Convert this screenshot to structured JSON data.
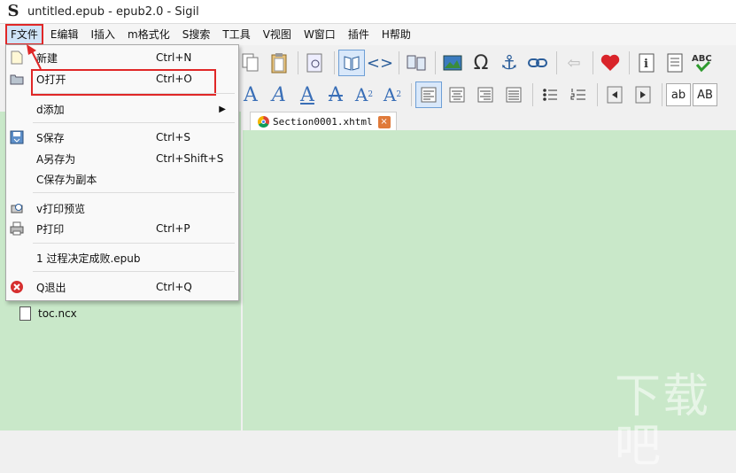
{
  "window": {
    "title": "untitled.epub - epub2.0 - Sigil",
    "logo_glyph": "S"
  },
  "menubar": {
    "items": [
      "F文件",
      "E编辑",
      "I插入",
      "m格式化",
      "S搜索",
      "T工具",
      "V视图",
      "W窗口",
      "插件",
      "H帮助"
    ]
  },
  "file_menu": {
    "items": [
      {
        "label": "新建",
        "shortcut": "Ctrl+N",
        "icon": "new-file-icon"
      },
      {
        "label": "O打开",
        "shortcut": "Ctrl+O",
        "icon": "open-folder-icon"
      },
      {
        "label": "d添加",
        "shortcut": "",
        "icon": "",
        "submenu": true
      },
      {
        "label": "S保存",
        "shortcut": "Ctrl+S",
        "icon": "save-icon"
      },
      {
        "label": "A另存为",
        "shortcut": "Ctrl+Shift+S",
        "icon": ""
      },
      {
        "label": "C保存为副本",
        "shortcut": "",
        "icon": ""
      },
      {
        "label": "v打印预览",
        "shortcut": "",
        "icon": "print-preview-icon"
      },
      {
        "label": "P打印",
        "shortcut": "Ctrl+P",
        "icon": "printer-icon"
      },
      {
        "label": "1 过程决定成败.epub",
        "shortcut": "",
        "icon": ""
      },
      {
        "label": "Q退出",
        "shortcut": "Ctrl+Q",
        "icon": "quit-icon"
      }
    ]
  },
  "toolbar": {
    "row2_format_buttons": [
      "A",
      "A",
      "A",
      "A",
      "A",
      "A"
    ],
    "subscript": "2",
    "superscript": "2",
    "right_buttons": [
      "ab",
      "AB"
    ],
    "code_view": "<>"
  },
  "tab": {
    "label": "Section0001.xhtml",
    "close": "×"
  },
  "book_browser": {
    "file": "toc.ncx"
  },
  "watermark": "下载吧",
  "colors": {
    "pane_bg": "#c9e8c9",
    "highlight_red": "#e02727"
  }
}
